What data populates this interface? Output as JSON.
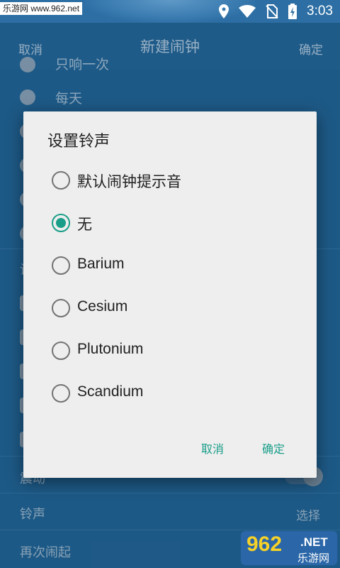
{
  "status_bar": {
    "watermark": "乐游网 www.962.net",
    "time": "3:03",
    "icons": [
      "location-icon",
      "wifi-icon",
      "no-sim-icon",
      "battery-charging-icon"
    ]
  },
  "header": {
    "cancel_label": "取消",
    "title": "新建闹钟",
    "ok_label": "确定"
  },
  "background": {
    "repeat_partial": "只响一次",
    "repeat_daily": "每天",
    "settings_partial": "设",
    "vibrate_label": "震动",
    "ringtone_label": "铃声",
    "ringtone_value": "选择",
    "snooze_label": "再次闹起"
  },
  "dialog": {
    "title": "设置铃声",
    "options": [
      {
        "label": "默认闹钟提示音",
        "checked": false
      },
      {
        "label": "无",
        "checked": true
      },
      {
        "label": "Barium",
        "checked": false
      },
      {
        "label": "Cesium",
        "checked": false
      },
      {
        "label": "Plutonium",
        "checked": false
      },
      {
        "label": "Scandium",
        "checked": false
      }
    ],
    "cancel_label": "取消",
    "ok_label": "确定"
  },
  "watermark_logo": {
    "num": "962",
    "net": ".NET",
    "cn": "乐游网"
  },
  "colors": {
    "accent": "#1a9e89",
    "app_bg": "#1f5d8c",
    "dialog_bg": "#eeeeee"
  }
}
